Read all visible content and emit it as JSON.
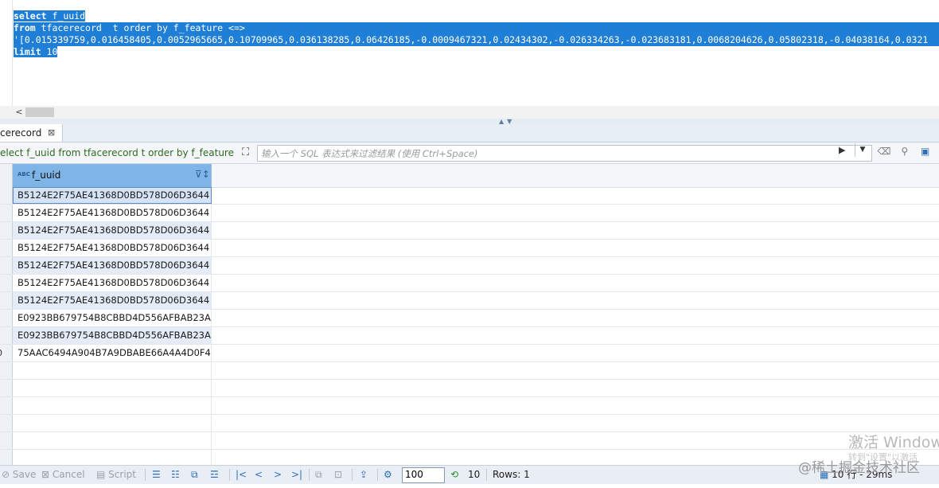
{
  "editor": {
    "lines": [
      {
        "kw": "select",
        "rest": " f_uuid",
        "full": false
      },
      {
        "kw": "from",
        "rest": " tfacerecord  t order by f_feature <=>",
        "full": true
      },
      {
        "kw": "",
        "rest": "'[0.015339759,0.016458405,0.0052965665,0.10709965,0.036138285,0.06426185,-0.0009467321,0.02434302,-0.026334263,-0.023683181,0.0068204626,0.05802318,-0.04038164,0.0321",
        "full": true
      },
      {
        "kw": "limit",
        "rest": " 10",
        "full": false
      }
    ]
  },
  "hscroll": {
    "left_arrow": "<"
  },
  "tab": {
    "label": "cerecord",
    "close": "⊠"
  },
  "filterbar": {
    "query": "elect f_uuid from tfacerecord t order by f_feature <=",
    "placeholder": "输入一个 SQL 表达式来过滤结果 (使用 Ctrl+Space)"
  },
  "grid": {
    "column": {
      "type_label": "ABC",
      "name": "f_uuid"
    },
    "rows": [
      {
        "num": "",
        "value": "B5124E2F75AE41368D0BD578D06D3644"
      },
      {
        "num": "",
        "value": "B5124E2F75AE41368D0BD578D06D3644"
      },
      {
        "num": "",
        "value": "B5124E2F75AE41368D0BD578D06D3644"
      },
      {
        "num": "",
        "value": "B5124E2F75AE41368D0BD578D06D3644"
      },
      {
        "num": "",
        "value": "B5124E2F75AE41368D0BD578D06D3644"
      },
      {
        "num": "",
        "value": "B5124E2F75AE41368D0BD578D06D3644"
      },
      {
        "num": "",
        "value": "B5124E2F75AE41368D0BD578D06D3644"
      },
      {
        "num": "",
        "value": "E0923BB679754B8CBBD4D556AFBAB23A"
      },
      {
        "num": "",
        "value": "E0923BB679754B8CBBD4D556AFBAB23A"
      },
      {
        "num": "0",
        "value": "75AAC6494A904B7A9DBABE66A4A4D0F4"
      }
    ],
    "empty_rows": 6
  },
  "toolbar": {
    "save": "Save",
    "cancel": "Cancel",
    "script": "Script",
    "page_size": "100",
    "fetched": "10",
    "rows": "Rows: 1",
    "status": "10 行 - 29ms"
  },
  "watermark": {
    "line1": "激活 Window",
    "line2": "转到\"设置\"以激活",
    "line3": "@稀土掘金技术社区"
  }
}
